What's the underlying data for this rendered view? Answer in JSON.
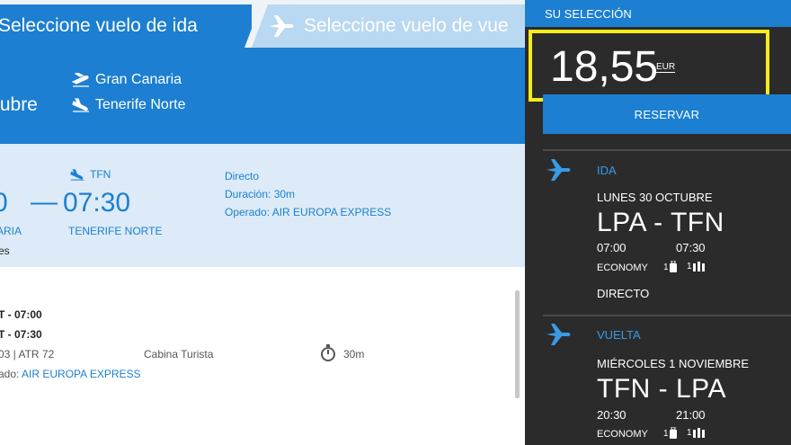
{
  "tabs": {
    "outbound": "Seleccione vuelo de ida",
    "return": "Seleccione vuelo de vue"
  },
  "route": {
    "date_fragment": "tubre",
    "origin": "Gran Canaria",
    "destination": "Tenerife Norte"
  },
  "flight": {
    "dep_time_fragment": "0",
    "dash": "—",
    "arr_time": "07:30",
    "arr_code": "TFN",
    "dep_city_fragment": "ARIA",
    "arr_city": "TENERIFE NORTE",
    "extra_fragment": "es",
    "type": "Directo",
    "duration": "Duración: 30m",
    "operated_label": "Operado:",
    "operated_by": "AIR EUROPA EXPRESS"
  },
  "detail": {
    "dep_line": "T - 07:00",
    "arr_line": "T - 07:30",
    "aircraft": "03 | ATR 72",
    "cabin": "Cabina Turista",
    "duration": "30m",
    "operated_label": "ado:",
    "operated_by": "AIR EUROPA EXPRESS"
  },
  "side": {
    "header": "SU SELECCIÓN",
    "price": "18,55",
    "currency": "EUR",
    "reserve": "RESERVAR",
    "outbound": {
      "kind": "IDA",
      "date": "LUNES 30 OCTUBRE",
      "route": "LPA - TFN",
      "dep": "07:00",
      "arr": "07:30",
      "cabin": "ECONOMY",
      "bag1": "1",
      "bag2": "1",
      "stops": "DIRECTO"
    },
    "return": {
      "kind": "VUELTA",
      "date": "MIÉRCOLES 1 NOVIEMBRE",
      "route": "TFN - LPA",
      "dep": "20:30",
      "arr": "21:00",
      "cabin": "ECONOMY",
      "bag1": "1",
      "bag2": "1"
    }
  },
  "colors": {
    "brand_blue": "#1c7fd1",
    "highlight": "#f4ec1c",
    "panel": "#2b2b2b"
  }
}
